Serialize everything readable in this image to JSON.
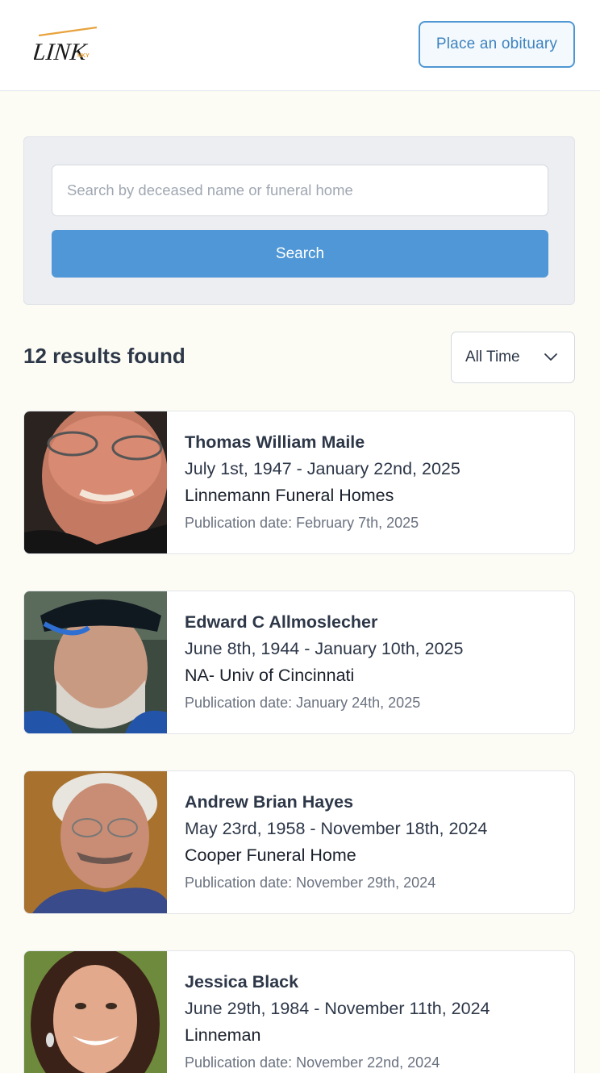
{
  "header": {
    "logo_text": "LINK",
    "logo_subtext": "NKY",
    "place_obituary_label": "Place an obituary"
  },
  "search": {
    "placeholder": "Search by deceased name or funeral home",
    "value": "",
    "button_label": "Search"
  },
  "results": {
    "count_label": "12 results found",
    "filter_selected": "All Time"
  },
  "obituaries": [
    {
      "name": "Thomas William Maile",
      "dates": "July 1st, 1947 - January 22nd, 2025",
      "funeral_home": "Linnemann Funeral Homes",
      "publication": "Publication date: February 7th, 2025"
    },
    {
      "name": "Edward C Allmoslecher",
      "dates": "June 8th, 1944 - January 10th, 2025",
      "funeral_home": "NA- Univ of Cincinnati",
      "publication": "Publication date: January 24th, 2025"
    },
    {
      "name": "Andrew Brian Hayes",
      "dates": "May 23rd, 1958 - November 18th, 2024",
      "funeral_home": "Cooper Funeral Home",
      "publication": "Publication date: November 29th, 2024"
    },
    {
      "name": "Jessica Black",
      "dates": "June 29th, 1984 - November 11th, 2024",
      "funeral_home": "Linneman",
      "publication": "Publication date: November 22nd, 2024"
    }
  ],
  "colors": {
    "accent": "#4f97d6",
    "background": "#fcfcf5",
    "text": "#2d3748",
    "muted": "#6b7280"
  }
}
